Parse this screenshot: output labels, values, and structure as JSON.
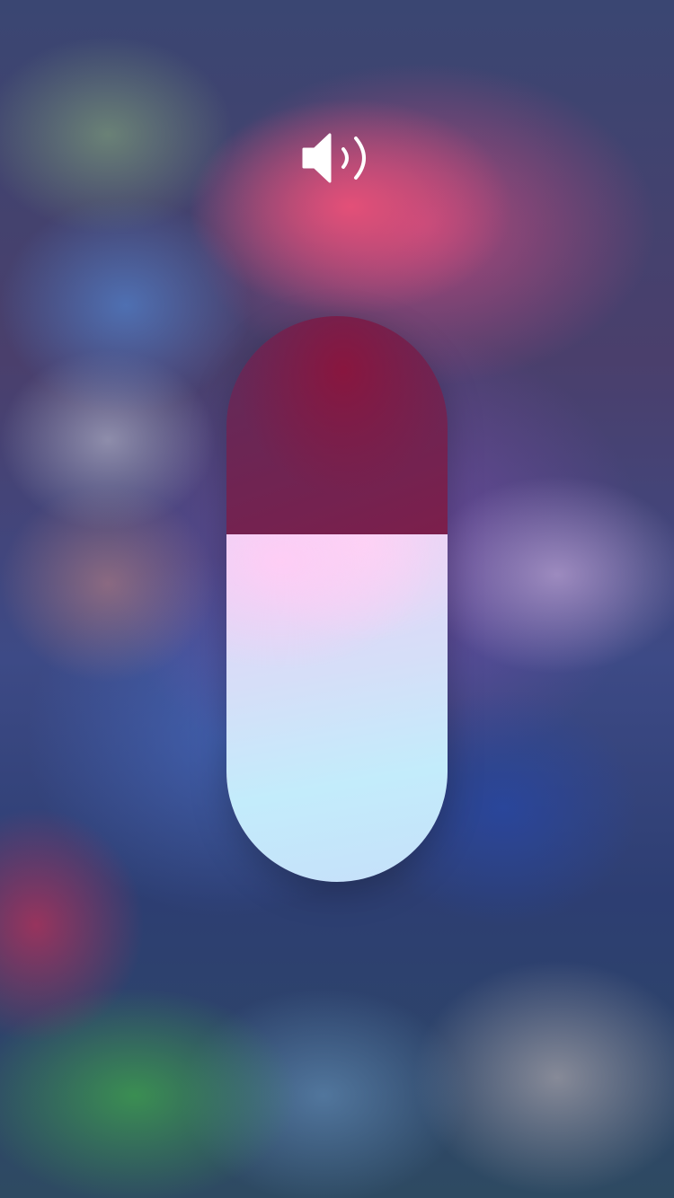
{
  "control": {
    "type": "volume",
    "icon": "speaker-wave-icon",
    "level_fraction": 0.615
  },
  "colors": {
    "icon": "#ffffff",
    "fill_top": "#e6d3f6",
    "fill_bottom": "#c3ecfb",
    "empty_track": "#7b1f4c"
  }
}
